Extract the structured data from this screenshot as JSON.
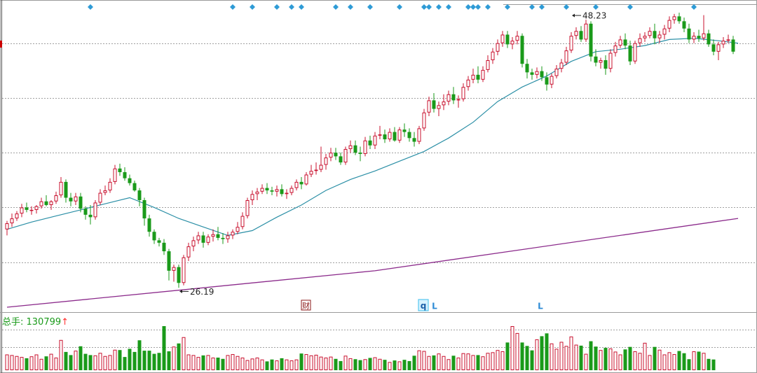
{
  "volume_panel": {
    "label": "总手: 130799",
    "arrow": "↑"
  },
  "markers": {
    "fin": "财",
    "q": "q",
    "l1": "L",
    "l2": "L"
  },
  "colors": {
    "up": "#c8102e",
    "down": "#1a9a1a",
    "ma_short": "#2b8fa6",
    "ma_long": "#8b2a8b",
    "diamond": "#2e9bd6",
    "grid": "#a0a0a0"
  },
  "chart_data": {
    "type": "candlestick",
    "ylim": [
      24.2,
      49.5
    ],
    "annotations": [
      {
        "text": "48.23",
        "index": 115,
        "value": 48.23,
        "kind": "high"
      },
      {
        "text": "26.19",
        "index": 35,
        "value": 26.19,
        "kind": "low"
      }
    ],
    "gridlines": [
      46.3,
      41.8,
      37.3,
      32.8,
      28.3
    ],
    "diamond_indices": [
      17,
      46,
      50,
      55,
      58,
      60,
      67,
      70,
      74,
      80,
      85,
      86,
      88,
      90,
      94,
      95,
      96,
      98,
      102,
      107,
      109,
      114,
      120,
      127,
      140
    ],
    "ohlc": [
      [
        31.0,
        31.7,
        30.5,
        31.5
      ],
      [
        31.5,
        32.3,
        31.2,
        31.9
      ],
      [
        31.9,
        32.5,
        31.7,
        32.3
      ],
      [
        32.3,
        33.1,
        32.0,
        32.8
      ],
      [
        32.8,
        33.2,
        32.4,
        32.6
      ],
      [
        32.6,
        32.9,
        32.2,
        32.6
      ],
      [
        32.6,
        33.0,
        32.3,
        32.9
      ],
      [
        32.9,
        33.6,
        32.7,
        33.3
      ],
      [
        33.3,
        33.8,
        32.9,
        33.0
      ],
      [
        33.0,
        33.4,
        32.6,
        33.3
      ],
      [
        33.3,
        34.1,
        33.1,
        33.8
      ],
      [
        33.8,
        35.3,
        33.6,
        34.9
      ],
      [
        34.9,
        35.1,
        33.2,
        33.6
      ],
      [
        33.6,
        34.0,
        32.9,
        33.3
      ],
      [
        33.3,
        34.0,
        33.0,
        33.7
      ],
      [
        33.7,
        34.0,
        32.4,
        32.7
      ],
      [
        32.7,
        32.9,
        31.8,
        32.2
      ],
      [
        32.2,
        33.0,
        31.4,
        32.0
      ],
      [
        32.0,
        33.4,
        31.8,
        33.2
      ],
      [
        33.2,
        34.3,
        33.0,
        34.0
      ],
      [
        34.0,
        34.6,
        33.8,
        34.2
      ],
      [
        34.2,
        35.2,
        34.0,
        34.9
      ],
      [
        34.9,
        36.3,
        34.7,
        36.0
      ],
      [
        36.0,
        36.4,
        35.4,
        35.7
      ],
      [
        35.7,
        36.1,
        35.0,
        35.2
      ],
      [
        35.2,
        35.5,
        34.6,
        34.8
      ],
      [
        34.8,
        35.0,
        34.1,
        34.2
      ],
      [
        34.2,
        34.4,
        32.9,
        33.4
      ],
      [
        33.4,
        33.6,
        31.3,
        31.9
      ],
      [
        31.9,
        32.2,
        30.4,
        30.8
      ],
      [
        30.8,
        31.0,
        29.8,
        30.1
      ],
      [
        30.1,
        30.3,
        29.6,
        29.9
      ],
      [
        29.9,
        30.2,
        28.9,
        29.2
      ],
      [
        29.2,
        29.4,
        26.8,
        27.6
      ],
      [
        27.6,
        28.1,
        26.7,
        27.9
      ],
      [
        27.9,
        28.1,
        26.2,
        26.6
      ],
      [
        26.6,
        28.9,
        26.4,
        28.7
      ],
      [
        28.7,
        29.9,
        28.4,
        29.6
      ],
      [
        29.6,
        30.4,
        29.2,
        30.1
      ],
      [
        30.1,
        30.8,
        29.8,
        30.5
      ],
      [
        30.5,
        30.8,
        29.5,
        29.9
      ],
      [
        29.9,
        30.6,
        29.7,
        30.4
      ],
      [
        30.4,
        31.0,
        30.0,
        30.6
      ],
      [
        30.6,
        31.2,
        30.1,
        30.3
      ],
      [
        30.3,
        30.7,
        29.8,
        30.2
      ],
      [
        30.2,
        30.8,
        29.9,
        30.5
      ],
      [
        30.5,
        31.0,
        30.2,
        30.8
      ],
      [
        30.8,
        31.6,
        30.6,
        31.2
      ],
      [
        31.2,
        32.4,
        31.0,
        32.1
      ],
      [
        32.1,
        33.6,
        31.9,
        33.4
      ],
      [
        33.4,
        34.2,
        33.0,
        33.9
      ],
      [
        33.9,
        34.4,
        33.4,
        34.1
      ],
      [
        34.1,
        34.7,
        33.9,
        34.4
      ],
      [
        34.4,
        34.8,
        33.9,
        34.2
      ],
      [
        34.2,
        34.5,
        33.8,
        34.1
      ],
      [
        34.1,
        34.6,
        33.7,
        34.3
      ],
      [
        34.3,
        34.7,
        33.7,
        33.9
      ],
      [
        33.9,
        34.3,
        33.5,
        34.0
      ],
      [
        34.0,
        34.6,
        33.8,
        34.4
      ],
      [
        34.4,
        35.1,
        34.2,
        34.9
      ],
      [
        34.9,
        35.3,
        34.3,
        34.7
      ],
      [
        34.7,
        35.7,
        34.6,
        35.5
      ],
      [
        35.5,
        36.3,
        35.3,
        35.8
      ],
      [
        35.8,
        36.5,
        35.5,
        35.9
      ],
      [
        35.9,
        37.8,
        35.7,
        36.3
      ],
      [
        36.3,
        37.2,
        35.9,
        36.9
      ],
      [
        36.9,
        37.7,
        36.6,
        37.3
      ],
      [
        37.3,
        37.7,
        36.7,
        37.0
      ],
      [
        37.0,
        37.3,
        36.3,
        36.5
      ],
      [
        36.5,
        37.8,
        36.3,
        37.6
      ],
      [
        37.6,
        38.3,
        37.3,
        37.9
      ],
      [
        37.9,
        38.3,
        37.1,
        37.3
      ],
      [
        37.3,
        37.8,
        36.6,
        37.2
      ],
      [
        37.2,
        38.6,
        37.0,
        38.3
      ],
      [
        38.3,
        38.7,
        37.6,
        37.9
      ],
      [
        37.9,
        39.0,
        37.6,
        38.7
      ],
      [
        38.7,
        39.5,
        38.4,
        38.8
      ],
      [
        38.8,
        39.2,
        38.1,
        38.4
      ],
      [
        38.4,
        39.3,
        38.2,
        39.0
      ],
      [
        39.0,
        39.4,
        38.2,
        38.3
      ],
      [
        38.3,
        39.4,
        38.1,
        39.2
      ],
      [
        39.2,
        39.7,
        38.6,
        39.0
      ],
      [
        39.0,
        39.3,
        38.2,
        38.5
      ],
      [
        38.5,
        39.0,
        37.8,
        38.2
      ],
      [
        38.2,
        39.5,
        38.0,
        39.3
      ],
      [
        39.3,
        40.9,
        39.1,
        40.6
      ],
      [
        40.6,
        41.9,
        40.3,
        41.6
      ],
      [
        41.6,
        42.2,
        40.6,
        40.9
      ],
      [
        40.9,
        41.5,
        40.3,
        41.2
      ],
      [
        41.2,
        42.1,
        40.8,
        41.5
      ],
      [
        41.5,
        42.4,
        41.2,
        42.1
      ],
      [
        42.1,
        42.7,
        41.3,
        41.6
      ],
      [
        41.6,
        42.0,
        41.0,
        41.7
      ],
      [
        41.7,
        43.0,
        41.5,
        42.7
      ],
      [
        42.7,
        43.6,
        42.4,
        43.3
      ],
      [
        43.3,
        44.2,
        43.0,
        43.7
      ],
      [
        43.7,
        44.4,
        43.0,
        43.3
      ],
      [
        43.3,
        44.4,
        43.1,
        44.1
      ],
      [
        44.1,
        45.3,
        43.9,
        44.9
      ],
      [
        44.9,
        45.9,
        44.6,
        45.6
      ],
      [
        45.6,
        46.6,
        45.3,
        46.3
      ],
      [
        46.3,
        47.3,
        46.0,
        47.0
      ],
      [
        47.0,
        47.3,
        45.9,
        46.2
      ],
      [
        46.2,
        46.8,
        45.8,
        46.5
      ],
      [
        46.5,
        47.3,
        46.2,
        46.9
      ],
      [
        46.9,
        47.1,
        44.3,
        44.6
      ],
      [
        44.6,
        45.0,
        43.4,
        43.9
      ],
      [
        43.9,
        44.2,
        43.3,
        43.7
      ],
      [
        43.7,
        44.3,
        43.4,
        44.0
      ],
      [
        44.0,
        44.4,
        43.2,
        43.5
      ],
      [
        43.5,
        43.9,
        42.4,
        42.9
      ],
      [
        42.9,
        43.8,
        42.6,
        43.6
      ],
      [
        43.6,
        44.5,
        43.4,
        44.2
      ],
      [
        44.2,
        45.0,
        43.9,
        44.7
      ],
      [
        44.7,
        46.0,
        44.5,
        45.7
      ],
      [
        45.7,
        47.2,
        45.5,
        46.9
      ],
      [
        46.9,
        47.6,
        46.6,
        47.3
      ],
      [
        47.3,
        47.7,
        46.4,
        46.6
      ],
      [
        46.6,
        48.23,
        46.4,
        47.9
      ],
      [
        47.9,
        48.1,
        44.8,
        45.2
      ],
      [
        45.2,
        45.8,
        44.4,
        44.7
      ],
      [
        44.7,
        45.1,
        44.2,
        44.9
      ],
      [
        44.9,
        45.3,
        43.7,
        44.2
      ],
      [
        44.2,
        45.8,
        43.9,
        45.5
      ],
      [
        45.5,
        46.4,
        45.2,
        46.1
      ],
      [
        46.1,
        46.9,
        45.9,
        46.6
      ],
      [
        46.6,
        47.1,
        45.8,
        46.1
      ],
      [
        46.1,
        46.5,
        44.5,
        44.8
      ],
      [
        44.8,
        46.5,
        44.6,
        46.3
      ],
      [
        46.3,
        47.1,
        46.0,
        46.7
      ],
      [
        46.7,
        47.2,
        46.4,
        46.9
      ],
      [
        46.9,
        47.6,
        46.7,
        47.3
      ],
      [
        47.3,
        47.9,
        46.2,
        46.7
      ],
      [
        46.7,
        47.3,
        46.3,
        47.0
      ],
      [
        47.0,
        47.8,
        46.6,
        47.5
      ],
      [
        47.5,
        48.5,
        47.2,
        48.2
      ],
      [
        48.2,
        48.7,
        47.9,
        48.5
      ],
      [
        48.5,
        48.8,
        47.9,
        48.1
      ],
      [
        48.1,
        48.4,
        47.2,
        47.5
      ],
      [
        47.5,
        47.9,
        46.3,
        46.6
      ],
      [
        46.6,
        47.2,
        46.3,
        46.9
      ],
      [
        46.9,
        47.4,
        46.4,
        46.7
      ],
      [
        46.7,
        48.6,
        46.5,
        47.1
      ],
      [
        47.1,
        47.4,
        46.0,
        46.2
      ],
      [
        46.2,
        46.6,
        45.3,
        45.6
      ],
      [
        45.6,
        46.4,
        44.9,
        46.2
      ],
      [
        46.2,
        46.8,
        45.9,
        46.5
      ],
      [
        46.5,
        47.0,
        46.3,
        46.6
      ],
      [
        46.6,
        46.9,
        45.4,
        45.6
      ]
    ],
    "volume_ylim": [
      0,
      140000
    ],
    "volume": [
      50000,
      48000,
      45000,
      42000,
      38000,
      44000,
      50000,
      36000,
      44000,
      52000,
      40000,
      96000,
      58000,
      48000,
      62000,
      76000,
      52000,
      48000,
      47000,
      55000,
      45000,
      48000,
      65000,
      64000,
      42000,
      68000,
      58000,
      95000,
      62000,
      62000,
      52000,
      55000,
      140000,
      60000,
      75000,
      85000,
      105000,
      50000,
      48000,
      42000,
      47000,
      48000,
      40000,
      40000,
      36000,
      48000,
      51000,
      45000,
      40000,
      32000,
      37000,
      40000,
      34000,
      28000,
      34000,
      31000,
      38000,
      34000,
      31000,
      34000,
      53000,
      51000,
      47000,
      49000,
      43000,
      40000,
      43000,
      36000,
      29000,
      46000,
      38000,
      35000,
      32000,
      35000,
      39000,
      41000,
      36000,
      33000,
      26000,
      31000,
      28000,
      33000,
      29000,
      46000,
      63000,
      61000,
      45000,
      47000,
      53000,
      45000,
      35000,
      46000,
      40000,
      54000,
      53000,
      48000,
      48000,
      44000,
      55000,
      57000,
      64000,
      60000,
      88000,
      140000,
      118000,
      88000,
      77000,
      63000,
      98000,
      108000,
      117000,
      85000,
      68000,
      90000,
      77000,
      107000,
      81000,
      78000,
      52000,
      92000,
      75000,
      64000,
      71000,
      69000,
      59000,
      50000,
      66000,
      74000,
      60000,
      55000,
      87000,
      48000,
      74000,
      65000,
      50000,
      57000,
      51000,
      61000,
      54000,
      35000,
      60000,
      59000,
      55000,
      36000,
      34000
    ],
    "ma_short_points": [
      [
        0,
        31.0
      ],
      [
        5,
        31.6
      ],
      [
        10,
        32.1
      ],
      [
        15,
        32.6
      ],
      [
        20,
        33.1
      ],
      [
        25,
        33.6
      ],
      [
        30,
        32.8
      ],
      [
        35,
        31.9
      ],
      [
        40,
        31.2
      ],
      [
        45,
        30.5
      ],
      [
        50,
        30.9
      ],
      [
        55,
        32.0
      ],
      [
        60,
        33.0
      ],
      [
        65,
        34.2
      ],
      [
        70,
        35.1
      ],
      [
        75,
        35.8
      ],
      [
        80,
        36.6
      ],
      [
        85,
        37.4
      ],
      [
        90,
        38.5
      ],
      [
        95,
        39.8
      ],
      [
        100,
        41.5
      ],
      [
        105,
        42.7
      ],
      [
        110,
        43.6
      ],
      [
        115,
        44.8
      ],
      [
        120,
        45.6
      ],
      [
        125,
        45.8
      ],
      [
        130,
        46.1
      ],
      [
        135,
        46.6
      ],
      [
        140,
        46.7
      ],
      [
        145,
        46.5
      ],
      [
        149,
        46.3
      ]
    ],
    "ma_long_points": [
      [
        0,
        24.6
      ],
      [
        75,
        27.6
      ],
      [
        149,
        31.9
      ]
    ]
  }
}
